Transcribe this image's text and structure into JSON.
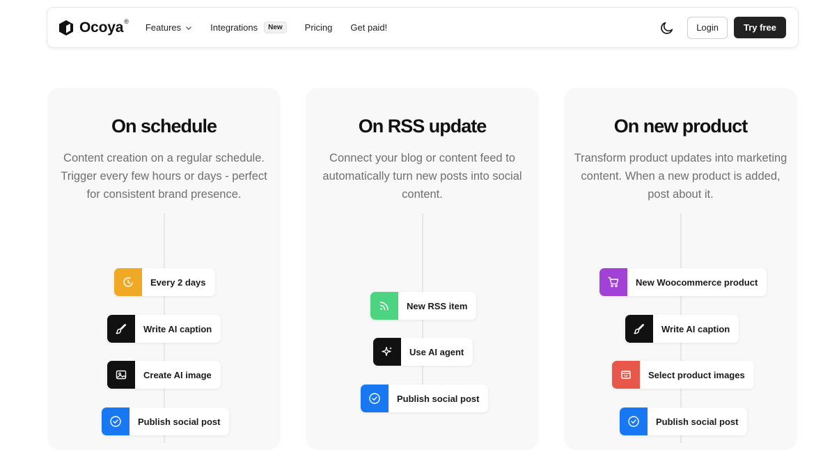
{
  "nav": {
    "logo_text": "Ocoya",
    "logo_mark": "®",
    "links": {
      "features": "Features",
      "integrations": "Integrations",
      "integrations_badge": "New",
      "pricing": "Pricing",
      "get_paid": "Get paid!"
    },
    "login": "Login",
    "try_free": "Try free"
  },
  "cards": [
    {
      "title": "On schedule",
      "description": "Content creation on a regular schedule. Trigger every few hours or days - perfect for consistent brand presence.",
      "steps": [
        {
          "label": "Every 2 days",
          "icon": "timer-icon",
          "color": "#f0a925"
        },
        {
          "label": "Write AI caption",
          "icon": "brush-icon",
          "color": "#111111"
        },
        {
          "label": "Create AI image",
          "icon": "image-icon",
          "color": "#111111"
        },
        {
          "label": "Publish social post",
          "icon": "check-circle-icon",
          "color": "#1877f2"
        }
      ]
    },
    {
      "title": "On RSS update",
      "description": "Connect your blog or content feed to automatically turn new posts into social content.",
      "steps": [
        {
          "label": "New RSS item",
          "icon": "rss-icon",
          "color": "#4cd480"
        },
        {
          "label": "Use AI agent",
          "icon": "sparkle-icon",
          "color": "#111111"
        },
        {
          "label": "Publish social post",
          "icon": "check-circle-icon",
          "color": "#1877f2"
        }
      ]
    },
    {
      "title": "On new product",
      "description": "Transform product updates into marketing content. When a new product is added, post about it.",
      "steps": [
        {
          "label": "New Woocommerce product",
          "icon": "cart-icon",
          "color": "#a241d6"
        },
        {
          "label": "Write AI caption",
          "icon": "brush-icon",
          "color": "#111111"
        },
        {
          "label": "Select product images",
          "icon": "box-icon",
          "color": "#e8584a"
        },
        {
          "label": "Publish social post",
          "icon": "check-circle-icon",
          "color": "#1877f2"
        }
      ]
    }
  ]
}
